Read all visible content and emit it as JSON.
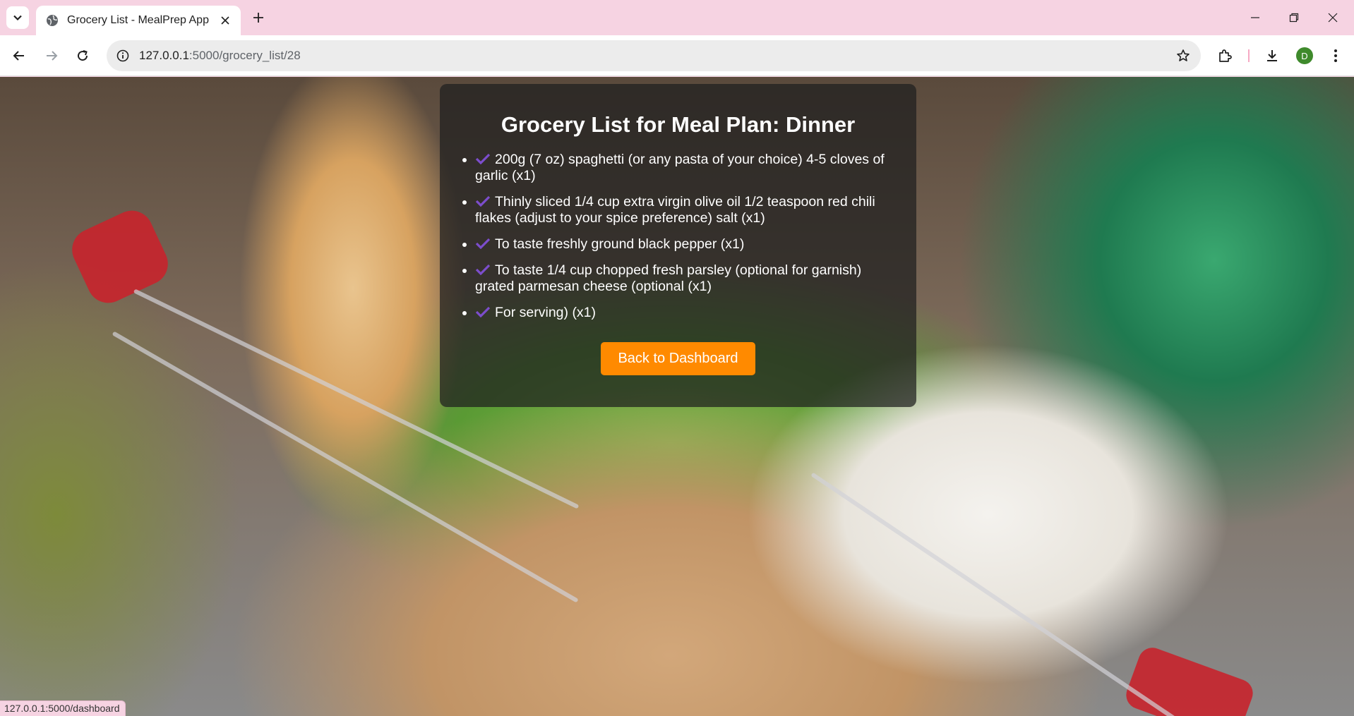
{
  "browser": {
    "tab_title": "Grocery List - MealPrep App",
    "url_host": "127.0.0.1",
    "url_path": ":5000/grocery_list/28",
    "profile_initial": "D",
    "status_url": "127.0.0.1:5000/dashboard"
  },
  "card": {
    "title": "Grocery List for Meal Plan: Dinner",
    "items": [
      "200g (7 oz) spaghetti (or any pasta of your choice) 4-5 cloves of garlic (x1)",
      "Thinly sliced 1/4 cup extra virgin olive oil 1/2 teaspoon red chili flakes (adjust to your spice preference) salt (x1)",
      "To taste freshly ground black pepper (x1)",
      "To taste 1/4 cup chopped fresh parsley (optional for garnish) grated parmesan cheese (optional (x1)",
      "For serving) (x1)"
    ],
    "back_button": "Back to Dashboard"
  },
  "colors": {
    "accent": "#ff8a00",
    "check": "#7c4dcc",
    "card_bg": "rgba(30,30,30,0.72)",
    "chrome_bg": "#f6d3e2"
  }
}
